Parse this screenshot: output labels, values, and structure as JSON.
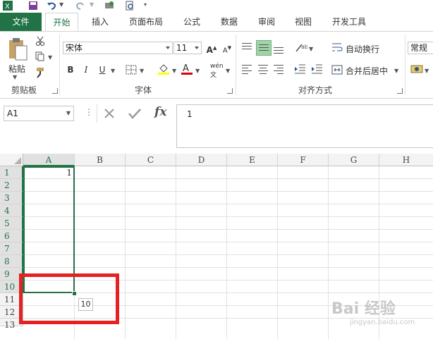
{
  "qat": {
    "icons": [
      "excel-logo-icon",
      "save-icon",
      "undo-icon",
      "redo-icon",
      "print-preview-icon",
      "customize-icon"
    ]
  },
  "tabs": [
    "文件",
    "开始",
    "插入",
    "页面布局",
    "公式",
    "数据",
    "审阅",
    "视图",
    "开发工具"
  ],
  "ribbon": {
    "clipboard": {
      "paste_label": "粘贴",
      "group_label": "剪贴板"
    },
    "font": {
      "font_name": "宋体",
      "font_size": "11",
      "bold": "B",
      "italic": "I",
      "underline": "U",
      "phonetic": "wén",
      "group_label": "字体"
    },
    "alignment": {
      "wrap_text": "自动换行",
      "merge_center": "合并后居中",
      "group_label": "对齐方式"
    },
    "number": {
      "format": "常规"
    }
  },
  "formula_bar": {
    "name_box": "A1",
    "fx_label": "fx",
    "value": "1"
  },
  "grid": {
    "columns": [
      "A",
      "B",
      "C",
      "D",
      "E",
      "F",
      "G",
      "H"
    ],
    "rows": [
      "1",
      "2",
      "3",
      "4",
      "5",
      "6",
      "7",
      "8",
      "9",
      "10",
      "11",
      "12",
      "13"
    ],
    "a1_value": "1",
    "fill_tooltip": "10"
  },
  "watermark": {
    "text": "Bai 经验",
    "sub": "jingyan.baidu.com"
  },
  "colors": {
    "accent": "#217346",
    "highlight": "#e52222"
  }
}
